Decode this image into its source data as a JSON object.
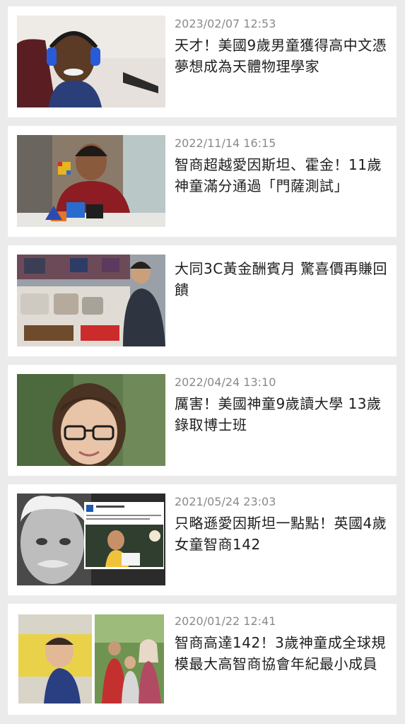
{
  "articles": [
    {
      "date": "2023/02/07 12:53",
      "title": "天才！美國9歲男童獲得高中文憑 夢想成為天體物理學家",
      "thumbnail": "boy-with-headphones-photo"
    },
    {
      "date": "2022/11/14 16:15",
      "title": "智商超越愛因斯坦、霍金！11歲神童滿分通過「門薩測試」",
      "thumbnail": "boy-with-rubiks-cubes-photo"
    },
    {
      "date": "",
      "title": "大同3C黃金酬賓月 驚喜價再賺回饋",
      "thumbnail": "appliance-store-photo"
    },
    {
      "date": "2022/04/24 13:10",
      "title": "厲害！美國神童9歲讀大學 13歲錄取博士班",
      "thumbnail": "girl-with-glasses-photo"
    },
    {
      "date": "2021/05/24 23:03",
      "title": "只略遜愛因斯坦一點點！英國4歲女童智商142",
      "thumbnail": "einstein-and-girl-photo"
    },
    {
      "date": "2020/01/22 12:41",
      "title": "智商高達142！3歲神童成全球規模最大高智商協會年紀最小成員",
      "thumbnail": "toddler-and-family-photo"
    }
  ]
}
